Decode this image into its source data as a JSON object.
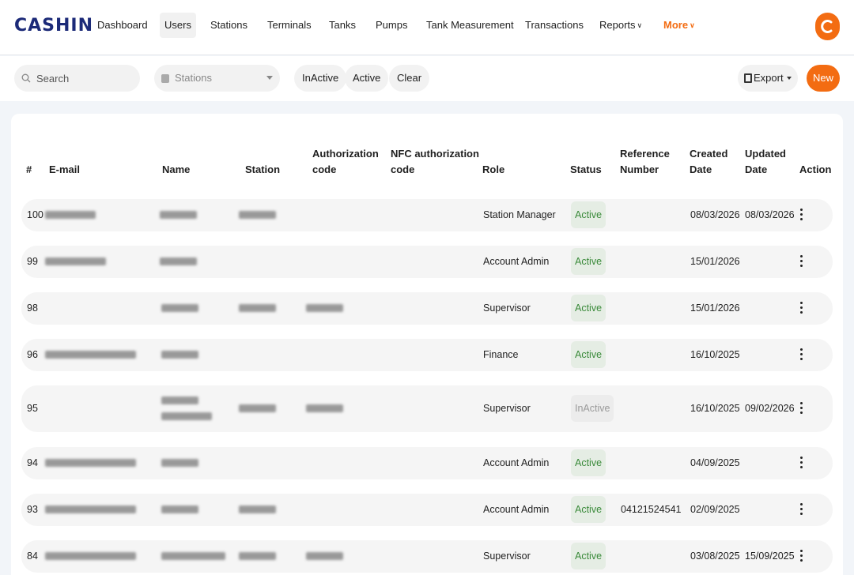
{
  "brand": {
    "logo_text": "CASHIN",
    "accent": "#f36c12",
    "navy": "#1c2a78"
  },
  "nav": {
    "items": [
      {
        "label": "Dashboard"
      },
      {
        "label": "Users",
        "selected": true
      },
      {
        "label": "Stations"
      },
      {
        "label": "Terminals"
      },
      {
        "label": "Tanks"
      },
      {
        "label": "Pumps"
      },
      {
        "label": "Tank Measurement"
      },
      {
        "label": "Transactions"
      },
      {
        "label": "Reports",
        "icon": "chevron-down-icon"
      },
      {
        "label": "More",
        "icon": "chevron-down-icon"
      }
    ],
    "avatar_icon": "user-avatar-icon"
  },
  "toolbar": {
    "search_placeholder": "Search",
    "stations_placeholder": "Stations",
    "filters": [
      "InActive",
      "Active",
      "Clear"
    ],
    "export_label": "Export",
    "new_label": "New"
  },
  "table": {
    "headers": {
      "index": "#",
      "email": "E-mail",
      "name": "Name",
      "station": "Station",
      "auth_code_1": "Authorization",
      "auth_code_2": "code",
      "nfc_1": "NFC authorization",
      "nfc_2": "code",
      "role": "Role",
      "status": "Status",
      "ref_1": "Reference",
      "ref_2": "Number",
      "created_1": "Created",
      "created_2": "Date",
      "updated_1": "Updated",
      "updated_2": "Date",
      "action": "Action"
    },
    "rows": [
      {
        "index": "100",
        "role": "Station Manager",
        "status": "Active",
        "reference": "",
        "created": "08/03/2026",
        "updated": "08/03/2026"
      },
      {
        "index": "99",
        "role": "Account Admin",
        "status": "Active",
        "reference": "",
        "created": "15/01/2026",
        "updated": ""
      },
      {
        "index": "98",
        "role": "Supervisor",
        "status": "Active",
        "reference": "",
        "created": "15/01/2026",
        "updated": ""
      },
      {
        "index": "96",
        "role": "Finance",
        "status": "Active",
        "reference": "",
        "created": "16/10/2025",
        "updated": ""
      },
      {
        "index": "95",
        "role": "Supervisor",
        "status": "InActive",
        "reference": "",
        "created": "16/10/2025",
        "updated": "09/02/2026"
      },
      {
        "index": "94",
        "role": "Account Admin",
        "status": "Active",
        "reference": "",
        "created": "04/09/2025",
        "updated": ""
      },
      {
        "index": "93",
        "role": "Account Admin",
        "status": "Active",
        "reference": "04121524541",
        "created": "02/09/2025",
        "updated": ""
      },
      {
        "index": "84",
        "role": "Supervisor",
        "status": "Active",
        "reference": "",
        "created": "03/08/2025",
        "updated": "15/09/2025"
      }
    ]
  }
}
